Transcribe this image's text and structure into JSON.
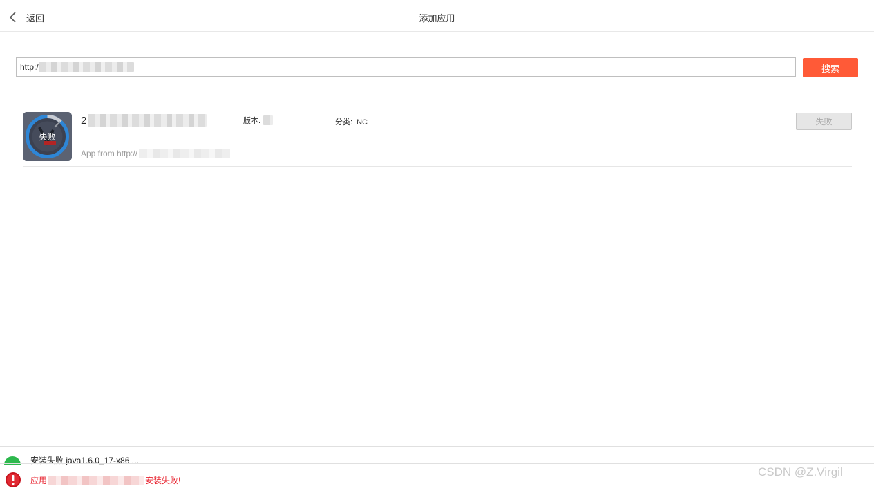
{
  "header": {
    "back_label": "返回",
    "title": "添加应用"
  },
  "search": {
    "value": "http:/",
    "button_label": "搜索"
  },
  "app": {
    "name_prefix": "2",
    "version_label": "版本.",
    "category_label": "分类:",
    "category_value": "NC",
    "source_prefix": "App from http://",
    "icon_status": "失败",
    "action_label": "失败"
  },
  "notifications": {
    "item1": "安装失败 java1.6.0_17-x86 ...",
    "item2_prefix": "应用",
    "item2_suffix": "安装失败!"
  },
  "watermark": "CSDN @Z.Virgil",
  "colors": {
    "accent": "#ff5a37",
    "error": "#e8222e",
    "success": "#2db84d"
  }
}
